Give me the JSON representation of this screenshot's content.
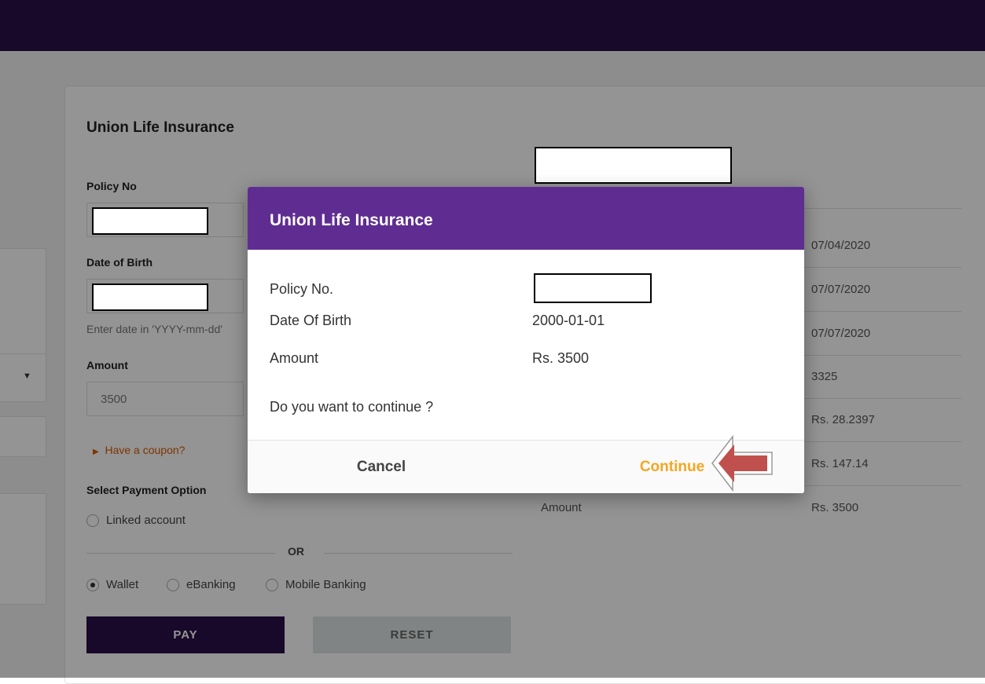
{
  "app": {
    "title": "Union Life Insurance"
  },
  "form": {
    "policy_label": "Policy No",
    "dob_label": "Date of Birth",
    "dob_hint": "Enter date in 'YYYY-mm-dd'",
    "amount_label": "Amount",
    "amount_value": "3500",
    "coupon_link": "Have a coupon?",
    "payment_heading": "Select Payment Option",
    "linked_account": "Linked account",
    "or_text": "OR",
    "options": [
      "Wallet",
      "eBanking",
      "Mobile Banking"
    ],
    "selected_option": "Wallet",
    "pay_label": "PAY",
    "reset_label": "RESET"
  },
  "summary": {
    "dates": [
      "07/04/2020",
      "07/07/2020",
      "07/07/2020"
    ],
    "value_3325": "3325",
    "value_rate": "Rs. 28.2397",
    "value_fee": "Rs. 147.14",
    "amount_label": "Amount",
    "amount_value": "Rs. 3500"
  },
  "modal": {
    "title": "Union Life Insurance",
    "policy_label": "Policy No.",
    "dob_label": "Date Of Birth",
    "dob_value": "2000-01-01",
    "amount_label": "Amount",
    "amount_value": "Rs. 3500",
    "question": "Do you want to continue ?",
    "cancel_label": "Cancel",
    "continue_label": "Continue"
  },
  "colors": {
    "topbar": "#2a0f47",
    "modal_header": "#5f2d91",
    "continue": "#f5a623",
    "arrow": "#c0504d"
  }
}
